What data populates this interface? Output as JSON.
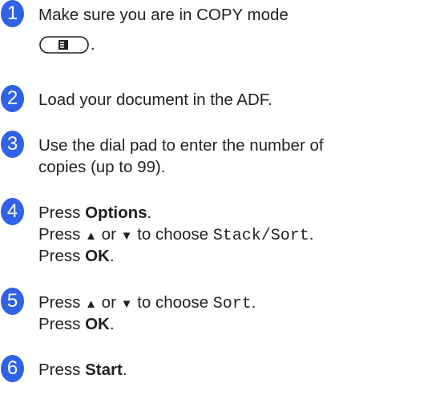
{
  "steps": [
    {
      "number": "1",
      "text": "Make sure you are in COPY mode",
      "after_icon": "."
    },
    {
      "number": "2",
      "text": "Load your document in the ADF."
    },
    {
      "number": "3",
      "line1": "Use the dial pad to enter the number of",
      "line2": "copies (up to 99)."
    },
    {
      "number": "4",
      "press": "Press",
      "options": "Options",
      "press_up": "Press",
      "up_glyph": "▲",
      "or": "or",
      "down_glyph": "▼",
      "to_choose": "to choose",
      "menu_value": "Stack/Sort",
      "period": ".",
      "ok": "OK"
    },
    {
      "number": "5",
      "press": "Press",
      "up_glyph": "▲",
      "or": "or",
      "down_glyph": "▼",
      "to_choose": "to choose",
      "menu_value": "Sort",
      "period": ".",
      "ok": "OK"
    },
    {
      "number": "6",
      "press": "Press",
      "start": "Start",
      "period": "."
    }
  ],
  "icons": {
    "copy_key": "copy-mode-key-icon"
  },
  "colors": {
    "badge": "#2f62e6",
    "text": "#231f20"
  }
}
